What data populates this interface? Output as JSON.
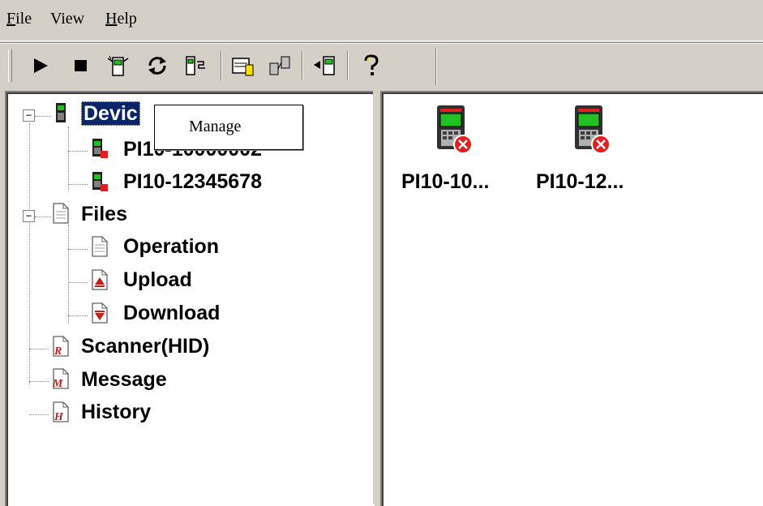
{
  "menu": {
    "file": "File",
    "file_hot": "F",
    "file_rest": "ile",
    "view": "View",
    "help": "Help",
    "help_hot": "H",
    "help_rest": "elp"
  },
  "toolbar": {
    "buttons": [
      "play-icon",
      "stop-icon",
      "device-connect-icon",
      "refresh-icon",
      "device-list-icon",
      "upload-device-icon",
      "network-devices-icon",
      "send-to-device-icon",
      "help-icon"
    ]
  },
  "tree": {
    "devices": "Devic",
    "device1": "PI10-10000002",
    "device2": "PI10-12345678",
    "files": "Files",
    "operation": "Operation",
    "upload": "Upload",
    "download": "Download",
    "scanner": "Scanner(HID)",
    "message": "Message",
    "history": "History"
  },
  "context_menu": {
    "manage": "Manage"
  },
  "devices_view": {
    "items": [
      {
        "label": "PI10-10..."
      },
      {
        "label": "PI10-12..."
      }
    ]
  },
  "colors": {
    "face": "#d4d0c8",
    "selection": "#0a246a",
    "device_green": "#22c022",
    "error_red": "#e02020"
  }
}
